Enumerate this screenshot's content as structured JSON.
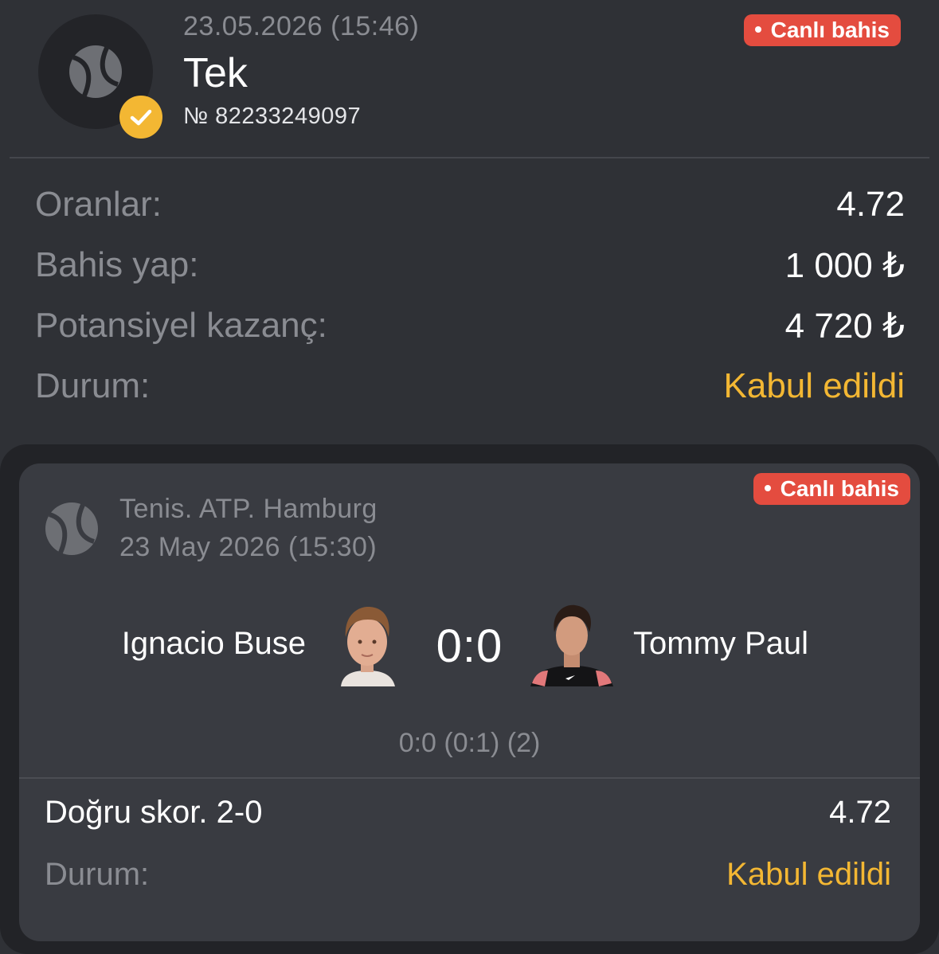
{
  "header": {
    "datetime": "23.05.2026 (15:46)",
    "bet_type": "Tek",
    "bet_number": "№ 82233249097",
    "badge": "Canlı bahis"
  },
  "summary": {
    "rows": [
      {
        "label": "Oranlar:",
        "value": "4.72"
      },
      {
        "label": "Bahis yap:",
        "value": "1 000 ₺"
      },
      {
        "label": "Potansiyel kazanç:",
        "value": "4 720 ₺"
      },
      {
        "label": "Durum:",
        "value": "Kabul edildi"
      }
    ]
  },
  "event": {
    "badge": "Canlı bahis",
    "tournament": "Tenis. ATP. Hamburg",
    "date": "23 May 2026 (15:30)",
    "player1": "Ignacio Buse",
    "player2": "Tommy Paul",
    "score": "0:0",
    "sub_score": "0:0 (0:1) (2)",
    "pick": "Doğru skor. 2-0",
    "pick_odds": "4.72",
    "status_label": "Durum:",
    "status_value": "Kabul edildi"
  },
  "colors": {
    "background": "#2f3136",
    "card": "#393b41",
    "accent": "#f3b733",
    "live_badge": "#e44c3f"
  },
  "icons": [
    "tennis-ball-icon",
    "checkmark-icon"
  ]
}
